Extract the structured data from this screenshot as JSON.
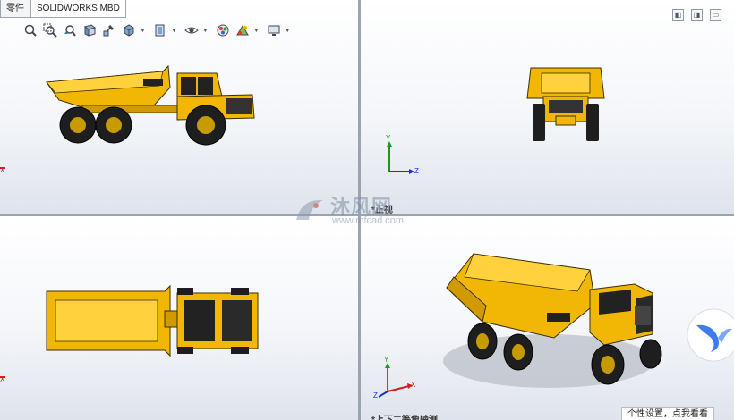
{
  "tabs": [
    {
      "label": "零件"
    },
    {
      "label": "SOLIDWORKS MBD"
    }
  ],
  "toolbar": {
    "icons": [
      "zoom-to-fit-icon",
      "zoom-to-area-icon",
      "previous-view-icon",
      "section-view-icon",
      "view-orientation-icon",
      "display-style-icon",
      "hide-show-items-icon",
      "edit-appearance-icon",
      "apply-scene-icon",
      "view-settings-icon",
      "monitor-icon"
    ]
  },
  "viewports": {
    "top_right": {
      "label": "*正视"
    },
    "bottom_right": {
      "label": "*上下二等角轴测"
    }
  },
  "triad_labels": {
    "x": "X",
    "y": "Y",
    "z": "Z"
  },
  "watermark": {
    "brand": "沐风网",
    "url": "www.mfcad.com"
  },
  "tooltip": {
    "text": "个性设置，点我看看"
  },
  "colors": {
    "truck_yellow": "#f2b705",
    "dark": "#222222",
    "axis_x": "#d02020",
    "axis_y": "#1a9a1a",
    "axis_z": "#1c2fd6"
  }
}
